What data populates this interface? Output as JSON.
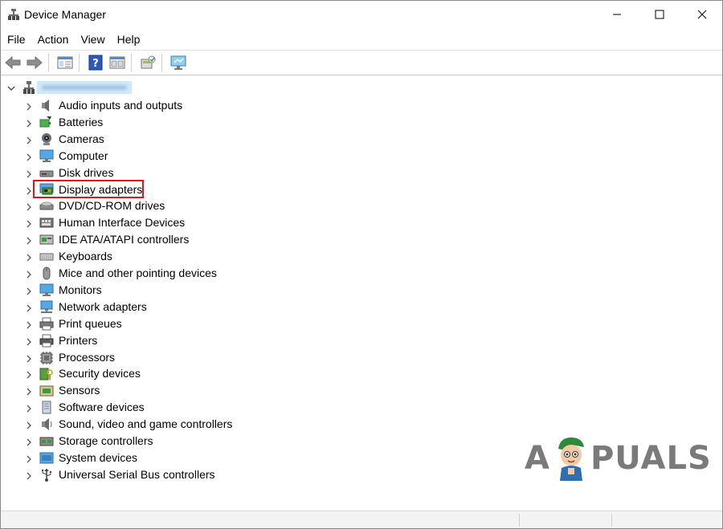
{
  "window": {
    "title": "Device Manager",
    "icon": "device-manager-icon",
    "controls": [
      "minimize-icon",
      "maximize-icon",
      "close-icon"
    ]
  },
  "menu": {
    "items": [
      "File",
      "Action",
      "View",
      "Help"
    ]
  },
  "toolbar": {
    "buttons": [
      "back-arrow-icon",
      "forward-arrow-icon",
      "properties-icon",
      "help-icon",
      "show-hide-icon",
      "update-driver-icon",
      "scan-hardware-icon"
    ]
  },
  "tree": {
    "root_icon": "computer-tree-icon",
    "categories": [
      {
        "label": "Audio inputs and outputs",
        "icon": "speaker-icon"
      },
      {
        "label": "Batteries",
        "icon": "battery-icon"
      },
      {
        "label": "Cameras",
        "icon": "camera-icon"
      },
      {
        "label": "Computer",
        "icon": "monitor-icon"
      },
      {
        "label": "Disk drives",
        "icon": "disk-drive-icon"
      },
      {
        "label": "Display adapters",
        "icon": "display-adapter-icon"
      },
      {
        "label": "DVD/CD-ROM drives",
        "icon": "dvd-drive-icon"
      },
      {
        "label": "Human Interface Devices",
        "icon": "hid-icon"
      },
      {
        "label": "IDE ATA/ATAPI controllers",
        "icon": "ide-controller-icon"
      },
      {
        "label": "Keyboards",
        "icon": "keyboard-icon"
      },
      {
        "label": "Mice and other pointing devices",
        "icon": "mouse-icon"
      },
      {
        "label": "Monitors",
        "icon": "monitor-icon"
      },
      {
        "label": "Network adapters",
        "icon": "network-adapter-icon"
      },
      {
        "label": "Print queues",
        "icon": "print-queue-icon"
      },
      {
        "label": "Printers",
        "icon": "printer-icon"
      },
      {
        "label": "Processors",
        "icon": "processor-icon"
      },
      {
        "label": "Security devices",
        "icon": "security-device-icon"
      },
      {
        "label": "Sensors",
        "icon": "sensor-icon"
      },
      {
        "label": "Software devices",
        "icon": "software-device-icon"
      },
      {
        "label": "Sound, video and game controllers",
        "icon": "sound-controller-icon"
      },
      {
        "label": "Storage controllers",
        "icon": "storage-controller-icon"
      },
      {
        "label": "System devices",
        "icon": "system-device-icon"
      },
      {
        "label": "Universal Serial Bus controllers",
        "icon": "usb-icon"
      }
    ],
    "highlighted": "Display adapters",
    "highlight_color": "#e0161e"
  },
  "watermark": {
    "left": "A",
    "right": "PUALS"
  }
}
